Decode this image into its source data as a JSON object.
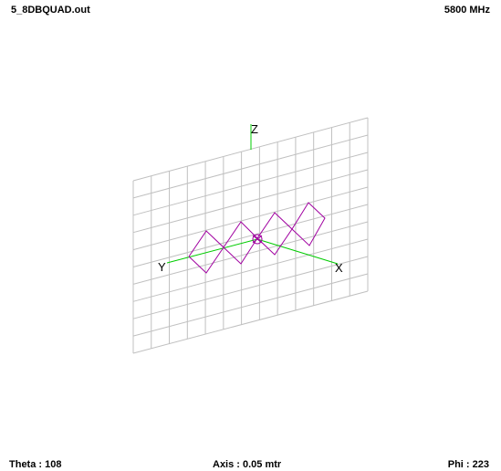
{
  "header": {
    "file_name": "5_8DBQUAD.out",
    "frequency": "5800 MHz"
  },
  "view": {
    "axis_labels": {
      "z": "Z",
      "y": "Y",
      "x": "X"
    },
    "colors": {
      "grid": "#c0c0c0",
      "axis": "#00cc00",
      "wire": "#a000a0"
    }
  },
  "status": {
    "theta": "Theta : 108",
    "axis": "Axis : 0.05 mtr",
    "phi": "Phi : 223"
  }
}
